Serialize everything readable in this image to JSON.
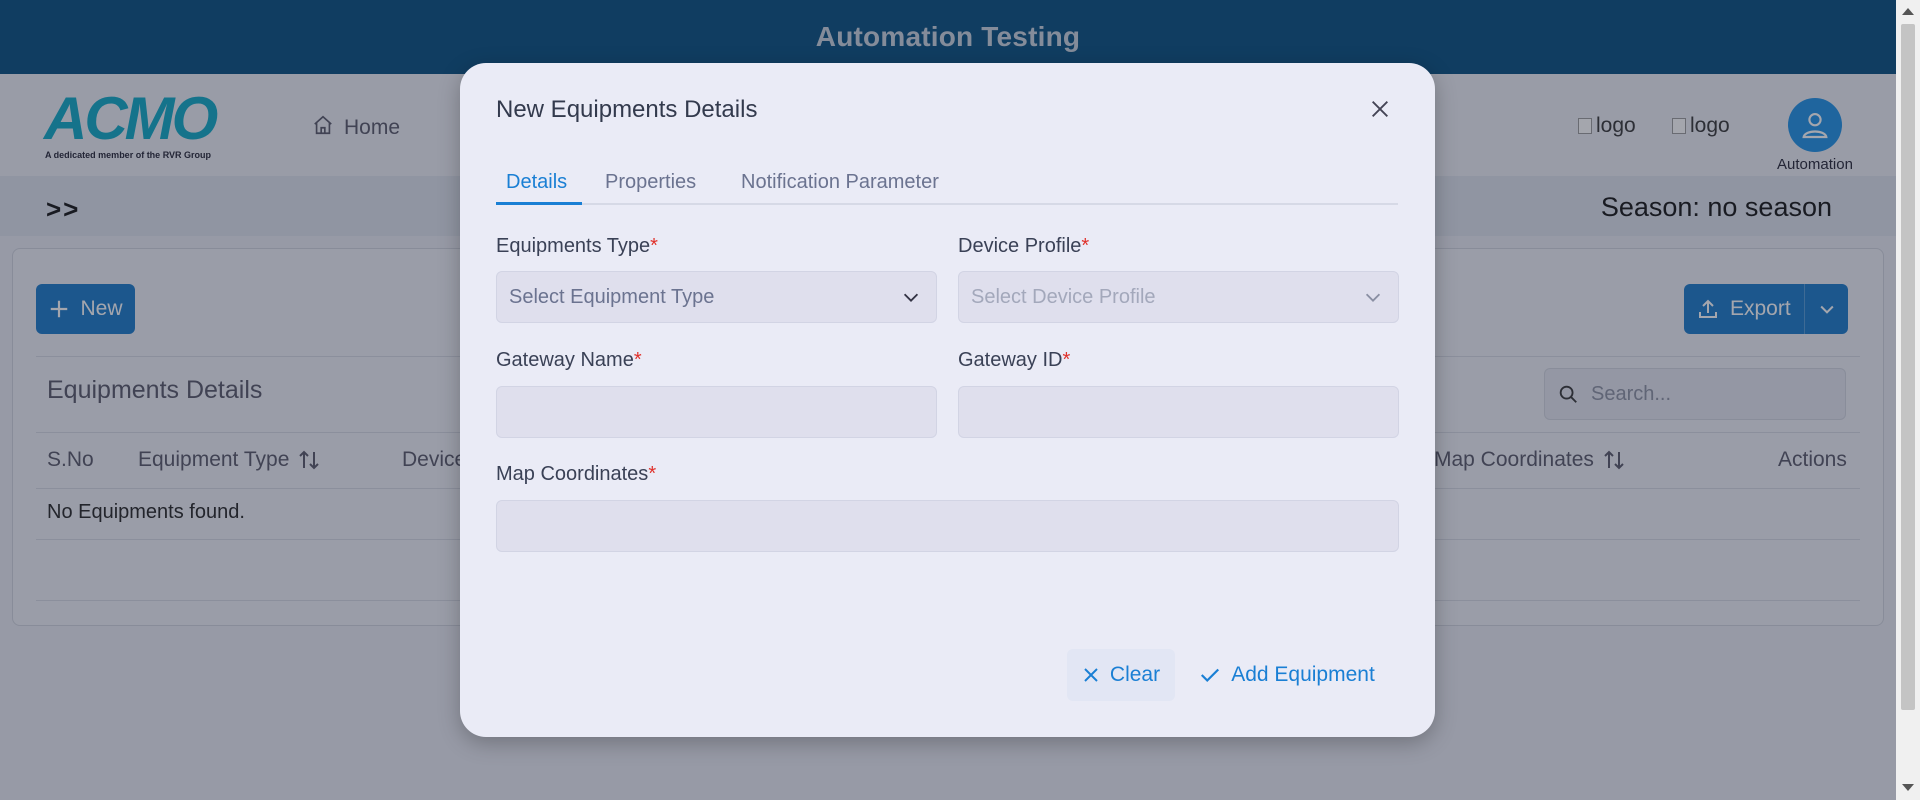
{
  "banner": {
    "title": "Automation Testing"
  },
  "header": {
    "logo_text": "ACMO",
    "logo_tagline": "A dedicated member of the RVR Group",
    "nav_home": "Home",
    "broken_images": [
      "logo",
      "logo"
    ],
    "user_name": "Automation"
  },
  "breadcrumb": {
    "chevrons": ">>",
    "season": "Season: no season"
  },
  "toolbar": {
    "new_label": "New",
    "export_label": "Export"
  },
  "equipments": {
    "title": "Equipments Details",
    "search_placeholder": "Search...",
    "columns": [
      "S.No",
      "Equipment Type",
      "Device",
      "Map Coordinates",
      "Actions"
    ],
    "empty_message": "No Equipments found."
  },
  "modal": {
    "title": "New Equipments Details",
    "tabs": [
      "Details",
      "Properties",
      "Notification Parameter"
    ],
    "active_tab": "Details",
    "fields": {
      "equipment_type": {
        "label": "Equipments Type",
        "placeholder": "Select Equipment Type",
        "required": "*"
      },
      "device_profile": {
        "label": "Device Profile",
        "placeholder": "Select Device Profile",
        "required": "*"
      },
      "gateway_name": {
        "label": "Gateway Name",
        "value": "",
        "required": "*"
      },
      "gateway_id": {
        "label": "Gateway ID",
        "value": "",
        "required": "*"
      },
      "map_coordinates": {
        "label": "Map Coordinates",
        "value": "",
        "required": "*"
      }
    },
    "clear_label": "Clear",
    "add_label": "Add Equipment"
  },
  "colors": {
    "banner": "#004b7c",
    "primary": "#1677c9",
    "link": "#1a7fd4",
    "required": "#e0302a",
    "modal_bg": "#eaebf6"
  }
}
